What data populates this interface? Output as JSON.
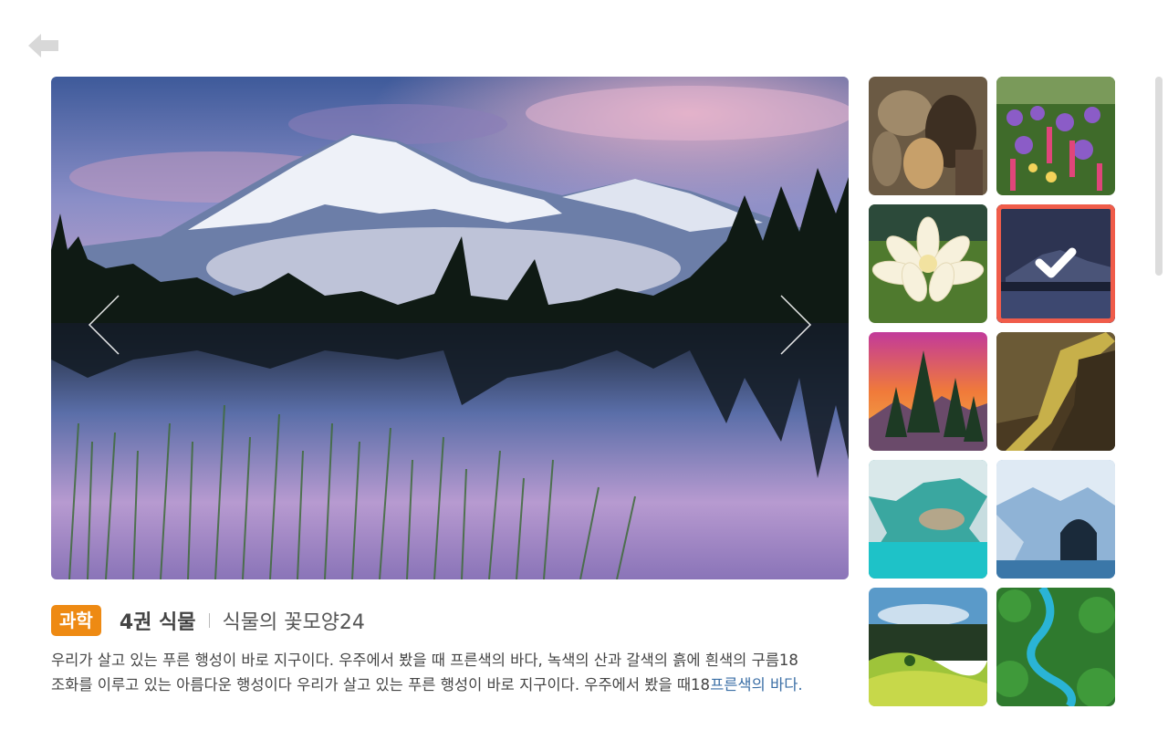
{
  "navigation": {
    "back_icon": "arrow-left-icon"
  },
  "viewer": {
    "prev_icon": "chevron-left-icon",
    "next_icon": "chevron-right-icon",
    "image_subject": "snow mountain reflected in lake"
  },
  "info": {
    "category": "과학",
    "volume": "4권 식물",
    "title": "식물의 꽃모양24",
    "description_main": "우리가 살고 있는 푸른 행성이 바로 지구이다. 우주에서 봤을 때 프른색의 바다, 녹색의 산과 갈색의 흙에 흰색의 구름18\n조화를 이루고 있는 아름다운 행성이다 우리가 살고 있는 푸른 행성이 바로 지구이다. 우주에서 봤을 때18",
    "description_tail": "프른색의 바다."
  },
  "gallery": {
    "thumbnails": [
      {
        "subject": "painting of horses and figures",
        "selected": false
      },
      {
        "subject": "colorful flower field",
        "selected": false
      },
      {
        "subject": "white water lily",
        "selected": false
      },
      {
        "subject": "mountain lake at dusk",
        "selected": true
      },
      {
        "subject": "sunset over pine trees",
        "selected": false
      },
      {
        "subject": "canyon river",
        "selected": false
      },
      {
        "subject": "turquoise sea cave",
        "selected": false
      },
      {
        "subject": "blue marble caves",
        "selected": false
      },
      {
        "subject": "green hills with forest",
        "selected": false
      },
      {
        "subject": "river through green forest",
        "selected": false
      }
    ],
    "selected_icon": "check-icon"
  },
  "colors": {
    "badge": "#ee8a13",
    "selection_border": "#f05c4a"
  }
}
